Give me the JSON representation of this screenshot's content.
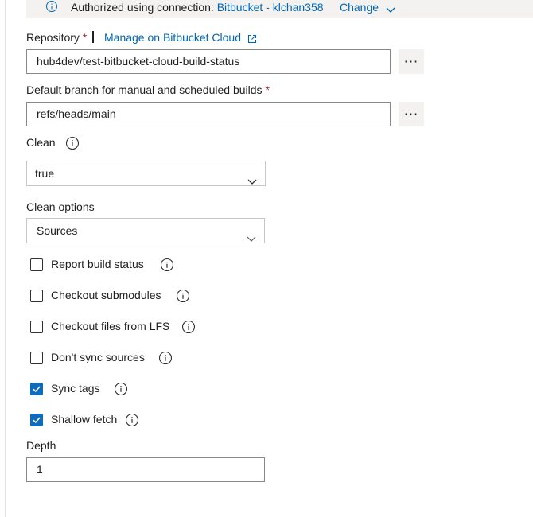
{
  "banner": {
    "text": "Authorized using connection:",
    "connection": "Bitbucket - klchan358",
    "change_label": "Change"
  },
  "repository": {
    "label": "Repository",
    "required_mark": "*",
    "manage_link": "Manage on Bitbucket Cloud",
    "value": "hub4dev/test-bitbucket-cloud-build-status",
    "more_label": "···"
  },
  "default_branch": {
    "label": "Default branch for manual and scheduled builds",
    "required_mark": "*",
    "value": "refs/heads/main",
    "more_label": "···"
  },
  "clean": {
    "label": "Clean",
    "selected": "true"
  },
  "clean_options": {
    "label": "Clean options",
    "selected": "Sources"
  },
  "checkboxes": [
    {
      "label": "Report build status",
      "checked": false
    },
    {
      "label": "Checkout submodules",
      "checked": false
    },
    {
      "label": "Checkout files from LFS",
      "checked": false
    },
    {
      "label": "Don't sync sources",
      "checked": false
    },
    {
      "label": "Sync tags",
      "checked": true
    },
    {
      "label": "Shallow fetch",
      "checked": true
    }
  ],
  "depth": {
    "label": "Depth",
    "value": "1"
  },
  "colors": {
    "link": "#0066b4",
    "required": "#a4262c",
    "checkbox_checked": "#0f6cbd"
  }
}
